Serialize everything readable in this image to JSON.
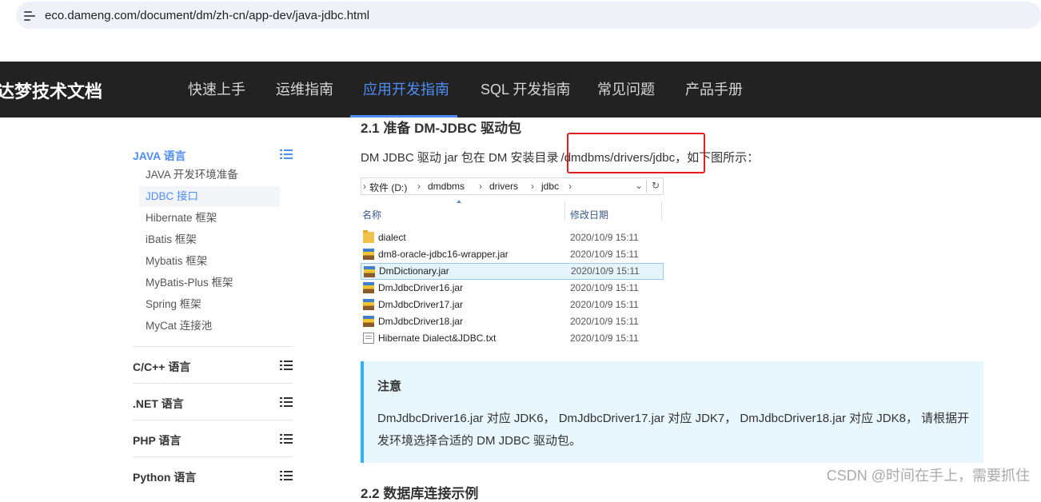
{
  "browser": {
    "url": "eco.dameng.com/document/dm/zh-cn/app-dev/java-jdbc.html"
  },
  "nav": {
    "brand": "达梦技术文档",
    "items": [
      "快速上手",
      "运维指南",
      "应用开发指南",
      "SQL 开发指南",
      "常见问题",
      "产品手册"
    ],
    "active": "应用开发指南",
    "accent": "#4f8ef7"
  },
  "sidebar": {
    "java_heading": "JAVA 语言",
    "java_items": [
      "JAVA 开发环境准备",
      "JDBC 接口",
      "Hibernate 框架",
      "iBatis 框架",
      "Mybatis 框架",
      "MyBatis-Plus 框架",
      "Spring 框架",
      "MyCat 连接池"
    ],
    "active_item": "JDBC 接口",
    "sections": [
      "C/C++ 语言",
      ".NET 语言",
      "PHP 语言",
      "Python 语言"
    ]
  },
  "content": {
    "section_title": "2.1 准备 DM-JDBC 驱动包",
    "para_before": "DM JDBC 驱动 jar 包在 DM 安装目录",
    "highlight_path": "/dmdbms/drivers/jdbc",
    "para_after": "，如下图所示：",
    "next_title": "2.2 数据库连接示例"
  },
  "explorer": {
    "breadcrumb": [
      "软件 (D:)",
      "dmdbms",
      "drivers",
      "jdbc"
    ],
    "col_name": "名称",
    "col_date": "修改日期",
    "files": [
      {
        "name": "dialect",
        "date": "2020/10/9 15:11",
        "icon": "folder-icon"
      },
      {
        "name": "dm8-oracle-jdbc16-wrapper.jar",
        "date": "2020/10/9 15:11",
        "icon": "jar-icon"
      },
      {
        "name": "DmDictionary.jar",
        "date": "2020/10/9 15:11",
        "icon": "jar-icon"
      },
      {
        "name": "DmJdbcDriver16.jar",
        "date": "2020/10/9 15:11",
        "icon": "jar-icon"
      },
      {
        "name": "DmJdbcDriver17.jar",
        "date": "2020/10/9 15:11",
        "icon": "jar-icon"
      },
      {
        "name": "DmJdbcDriver18.jar",
        "date": "2020/10/9 15:11",
        "icon": "jar-icon"
      },
      {
        "name": "Hibernate Dialect&JDBC.txt",
        "date": "2020/10/9 15:11",
        "icon": "text-file-icon"
      }
    ],
    "selected": "DmDictionary.jar"
  },
  "note": {
    "title": "注意",
    "text": "DmJdbcDriver16.jar 对应 JDK6， DmJdbcDriver17.jar 对应 JDK7， DmJdbcDriver18.jar 对应 JDK8， 请根据开发环境选择合适的 DM JDBC 驱动包。"
  },
  "watermark": "CSDN @时间在手上，需要抓住",
  "colors": {
    "highlight_box": "#e02020",
    "note_border": "#29b6f6",
    "note_bg": "#e8f6fd"
  }
}
